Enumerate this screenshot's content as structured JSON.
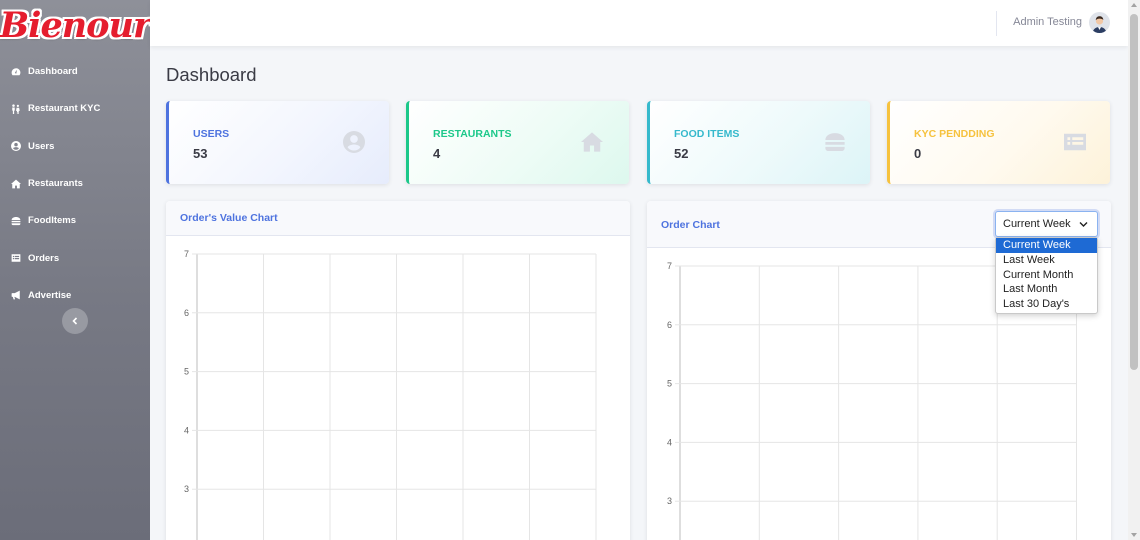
{
  "brand": {
    "name": "Bienour",
    "color": "#e51d2e"
  },
  "sidebar": {
    "items": [
      {
        "label": "Dashboard",
        "icon": "tachometer-icon"
      },
      {
        "label": "Restaurant KYC",
        "icon": "family-icon"
      },
      {
        "label": "Users",
        "icon": "user-circle-icon"
      },
      {
        "label": "Restaurants",
        "icon": "home-icon"
      },
      {
        "label": "FoodItems",
        "icon": "burger-icon"
      },
      {
        "label": "Orders",
        "icon": "list-icon"
      },
      {
        "label": "Advertise",
        "icon": "bullhorn-icon"
      }
    ],
    "collapse_icon": "chevron-left-icon"
  },
  "topbar": {
    "user_name": "Admin Testing",
    "avatar_icon": "user-avatar-icon"
  },
  "page": {
    "title": "Dashboard"
  },
  "stats": {
    "users": {
      "label": "USERS",
      "value": "53",
      "icon": "user-circle-icon",
      "color": "#4e73df"
    },
    "restaurants": {
      "label": "RESTAURANTS",
      "value": "4",
      "icon": "home-icon",
      "color": "#1cc88a"
    },
    "food_items": {
      "label": "FOOD ITEMS",
      "value": "52",
      "icon": "burger-icon",
      "color": "#36b9cc"
    },
    "kyc": {
      "label": "KYC PENDDING",
      "value": "0",
      "icon": "list-alt-icon",
      "color": "#f6c23e"
    }
  },
  "charts": {
    "order_value": {
      "title": "Order's Value Chart"
    },
    "order": {
      "title": "Order Chart"
    }
  },
  "period_select": {
    "value": "Current Week",
    "options": [
      "Current Week",
      "Last Week",
      "Current Month",
      "Last Month",
      "Last 30 Day's"
    ]
  },
  "chart_data": [
    {
      "type": "bar",
      "title": "",
      "categories": [],
      "series": [],
      "ylim": [
        2,
        7
      ],
      "y_ticks": [
        "7",
        "6",
        "5",
        "4",
        "3"
      ],
      "grid": true
    },
    {
      "type": "bar",
      "title": "",
      "categories": [],
      "series": [],
      "ylim": [
        2,
        7
      ],
      "y_ticks": [
        "7",
        "6",
        "5",
        "4",
        "3"
      ],
      "grid": true
    }
  ]
}
